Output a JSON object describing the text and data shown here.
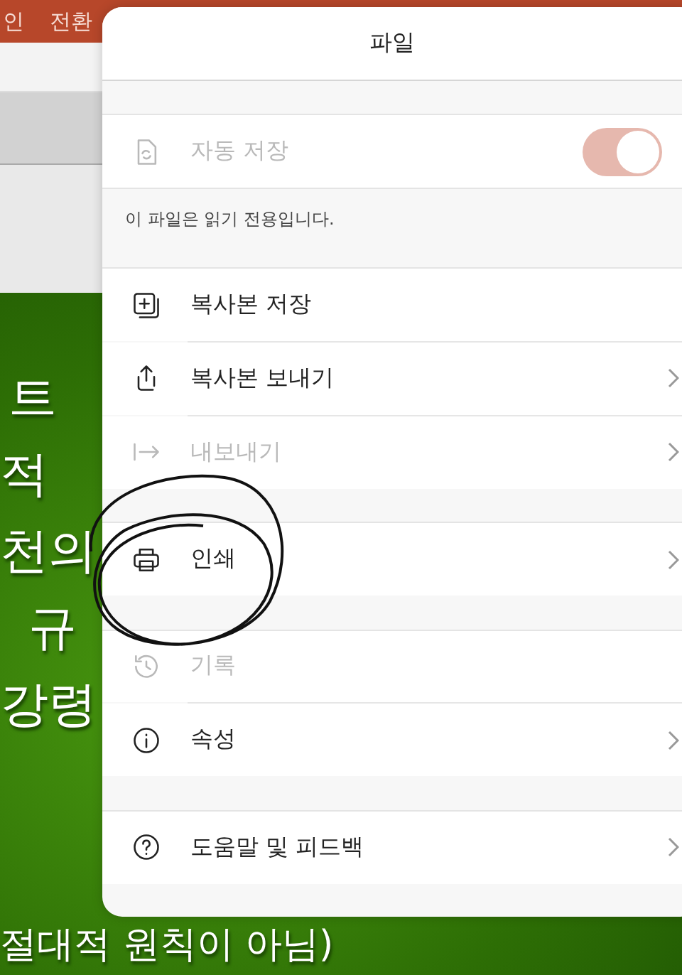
{
  "ribbon": {
    "tabs": [
      "인",
      "전환"
    ]
  },
  "slide": {
    "lines": [
      "트",
      "적",
      "천의",
      "규",
      "강령",
      "절대적 원칙이 아님)"
    ]
  },
  "panel": {
    "title": "파일",
    "autosave": {
      "label": "자동 저장",
      "on": true,
      "disabled": true
    },
    "note": "이 파일은 읽기 전용입니다.",
    "groups": [
      [
        {
          "label": "복사본 저장",
          "disabled": false,
          "submenu": false
        },
        {
          "label": "복사본 보내기",
          "disabled": false,
          "submenu": true
        },
        {
          "label": "내보내기",
          "disabled": true,
          "submenu": true
        }
      ],
      [
        {
          "label": "인쇄",
          "disabled": false,
          "submenu": true
        }
      ],
      [
        {
          "label": "기록",
          "disabled": true,
          "submenu": false
        },
        {
          "label": "속성",
          "disabled": false,
          "submenu": true
        }
      ],
      [
        {
          "label": "도움말 및 피드백",
          "disabled": false,
          "submenu": true
        }
      ]
    ]
  }
}
